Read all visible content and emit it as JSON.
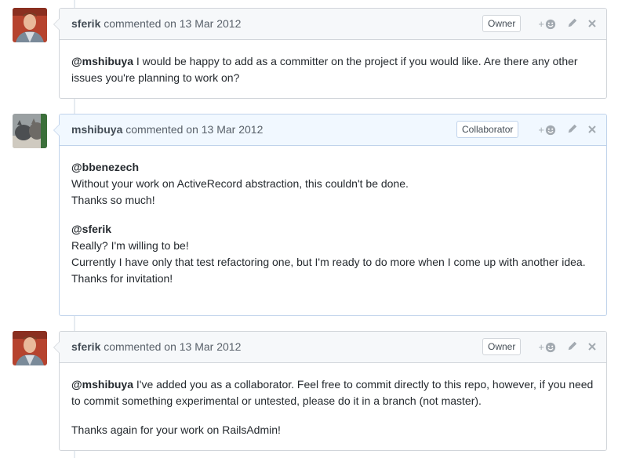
{
  "comments": [
    {
      "author": "sferik",
      "meta": "commented on 13 Mar 2012",
      "role": "Owner",
      "react_plus": "+",
      "paragraphs": [
        {
          "mention": "@mshibuya",
          "text": " I would be happy to add as a committer on the project if you would like. Are there any other issues you're planning to work on?"
        }
      ]
    },
    {
      "author": "mshibuya",
      "meta": "commented on 13 Mar 2012",
      "role": "Collaborator",
      "react_plus": "+",
      "paragraphs": [
        {
          "mention": "@bbenezech",
          "lines": [
            "Without your work on ActiveRecord abstraction, this couldn't be done.",
            "Thanks so much!"
          ]
        },
        {
          "mention": "@sferik",
          "lines": [
            "Really? I'm willing to be!",
            "Currently I have only that test refactoring one, but I'm ready to do more when I come up with another idea.",
            "Thanks for invitation!"
          ]
        }
      ]
    },
    {
      "author": "sferik",
      "meta": "commented on 13 Mar 2012",
      "role": "Owner",
      "react_plus": "+",
      "paragraphs": [
        {
          "mention": "@mshibuya",
          "text": " I've added you as a collaborator. Feel free to commit directly to this repo, however, if you need to commit something experimental or untested, please do it in a branch (not master)."
        },
        {
          "text": "Thanks again for your work on RailsAdmin!"
        }
      ]
    }
  ],
  "icons": {
    "reaction": "smiley-icon",
    "edit": "pencil-icon",
    "delete": "close-icon"
  },
  "colors": {
    "header_bg": "#f6f8fa",
    "header_bg_blue": "#f1f8ff",
    "border": "#d1d5da",
    "border_blue": "#c0d3eb"
  }
}
